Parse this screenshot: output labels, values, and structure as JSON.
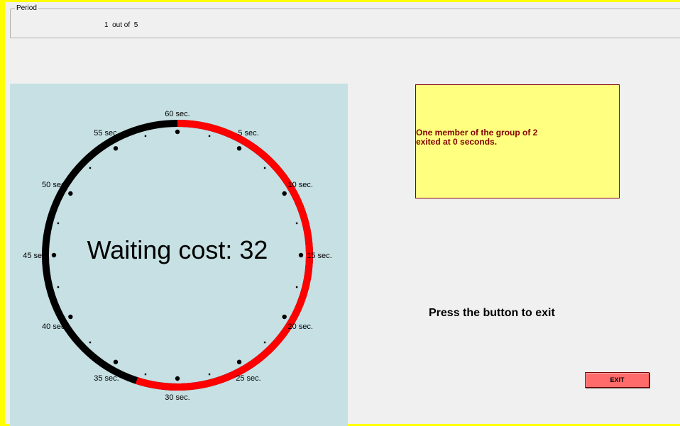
{
  "period": {
    "legend": "Period",
    "current": "1",
    "sep": "out of",
    "total": "5"
  },
  "clock": {
    "waiting_cost_label": "Waiting cost:",
    "waiting_cost_value": "32",
    "colors": {
      "elapsed": "#ff0000",
      "remaining": "#000000",
      "background": "#c6e0e3"
    },
    "elapsed_fraction": 0.55,
    "labels": [
      "60 sec.",
      "5 sec.",
      "10 sec.",
      "15 sec.",
      "20 sec.",
      "25 sec.",
      "30 sec.",
      "35 sec.",
      "40 sec.",
      "45 sec.",
      "50 sec.",
      "55 sec."
    ]
  },
  "info": {
    "line1": "One member of the group of 2",
    "line2": "exited at 0 seconds."
  },
  "instruction": "Press the button to exit",
  "exit_button": "EXIT"
}
